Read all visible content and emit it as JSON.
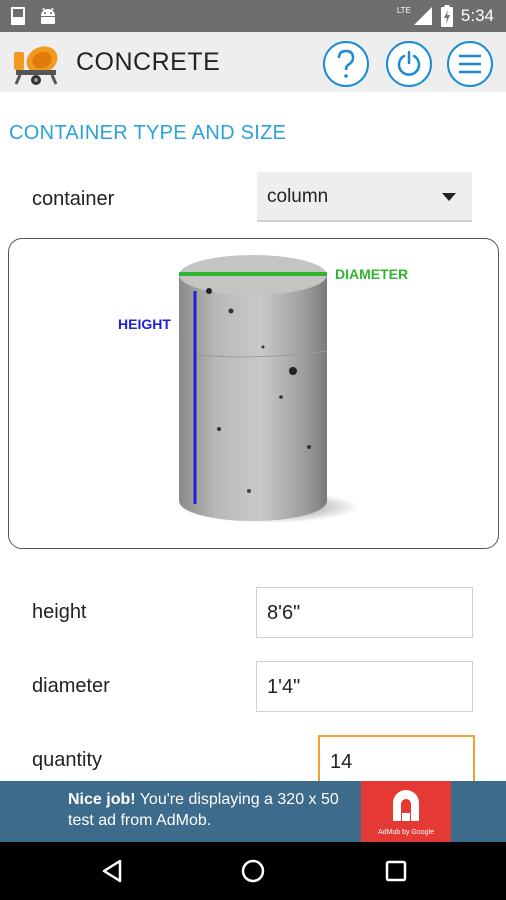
{
  "status_bar": {
    "time": "5:34",
    "network_label": "LTE",
    "icons": [
      "photo-icon",
      "android-icon",
      "signal-icon",
      "battery-icon"
    ]
  },
  "app_bar": {
    "title": "CONCRETE",
    "logo_icon": "cement-mixer-icon",
    "help_icon": "question-icon",
    "power_icon": "power-icon",
    "menu_icon": "menu-icon",
    "accent_color": "#1a8ad6"
  },
  "section": {
    "title": "CONTAINER TYPE AND SIZE",
    "title_color": "#29a3d9"
  },
  "container": {
    "label": "container",
    "selected": "column"
  },
  "diagram": {
    "height_label": "HEIGHT",
    "diameter_label": "DIAMETER",
    "height_color": "#1e22d6",
    "diameter_color": "#2fb52f"
  },
  "fields": {
    "height": {
      "label": "height",
      "value": "8'6\""
    },
    "diameter": {
      "label": "diameter",
      "value": "1'4\""
    },
    "quantity": {
      "label": "quantity",
      "value": "14",
      "focus_color": "#f0a030"
    }
  },
  "ad": {
    "bold": "Nice job!",
    "text": " You're displaying a 320 x 50 test ad from AdMob.",
    "brand": "AdMob by Google",
    "background": "#3d6b8b",
    "logo_color": "#e53935"
  },
  "nav_bar": {
    "icons": [
      "back-icon",
      "home-icon",
      "recents-icon"
    ]
  }
}
